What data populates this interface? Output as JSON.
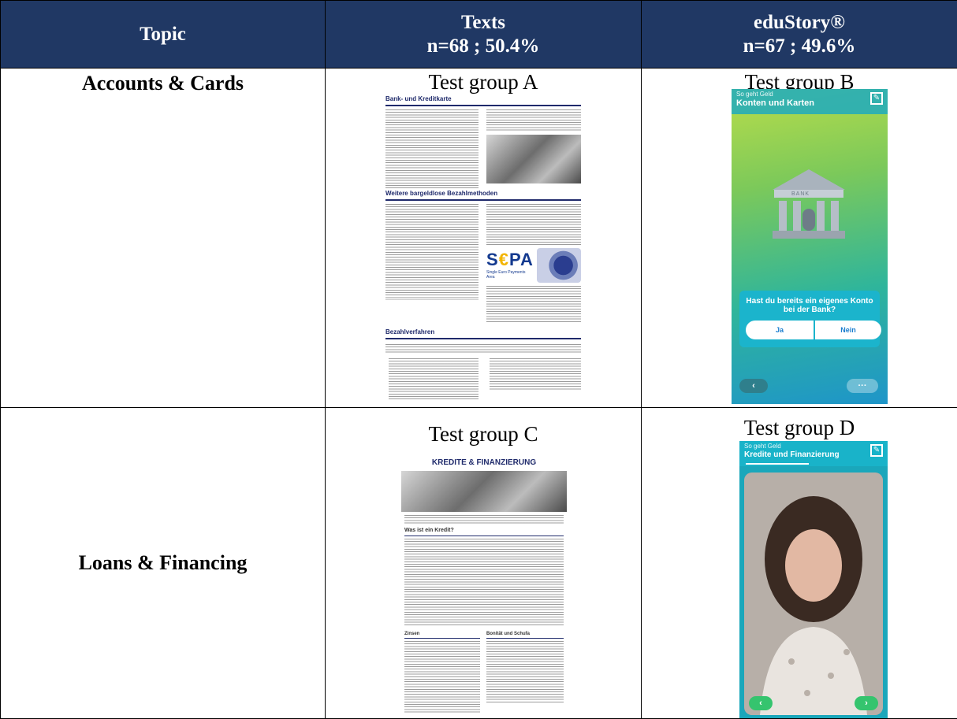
{
  "table": {
    "headers": [
      {
        "line1": "Topic",
        "line2": ""
      },
      {
        "line1": "Texts",
        "line2": "n=68 ; 50.4%"
      },
      {
        "line1": "eduStory®",
        "line2": "n=67 ; 49.6%"
      }
    ],
    "rows": [
      {
        "topic": "Accounts & Cards",
        "texts_group": "Test group A",
        "edustory_group": "Test group B"
      },
      {
        "topic": "Loans & Financing",
        "texts_group": "Test group C",
        "edustory_group": "Test group D"
      }
    ]
  },
  "doc_a": {
    "title": "Bank- und Kreditkarte",
    "section2": "Weitere bargeldlose Bezahlmethoden",
    "section3": "Bezahlverfahren",
    "sepa_logo": "S€PA",
    "sepa_sub": "Single Euro Payments Area"
  },
  "doc_c": {
    "title": "KREDITE & FINANZIERUNG",
    "q1": "Was ist ein Kredit?",
    "sub1": "Zinsen",
    "sub2": "Bonität und Schufa"
  },
  "app_b": {
    "supertitle": "So geht Geld",
    "title": "Konten und Karten",
    "bank_label": "BANK",
    "question": "Hast du bereits ein eigenes Konto bei der Bank?",
    "yes": "Ja",
    "no": "Nein",
    "back": "‹",
    "more": "···"
  },
  "app_d": {
    "supertitle": "So geht Geld",
    "title": "Kredite und Finanzierung",
    "back": "‹",
    "next": "›"
  },
  "colors": {
    "header_bg": "#203864",
    "app_teal": "#19b3c9",
    "doc_blue": "#1f2a6b"
  }
}
